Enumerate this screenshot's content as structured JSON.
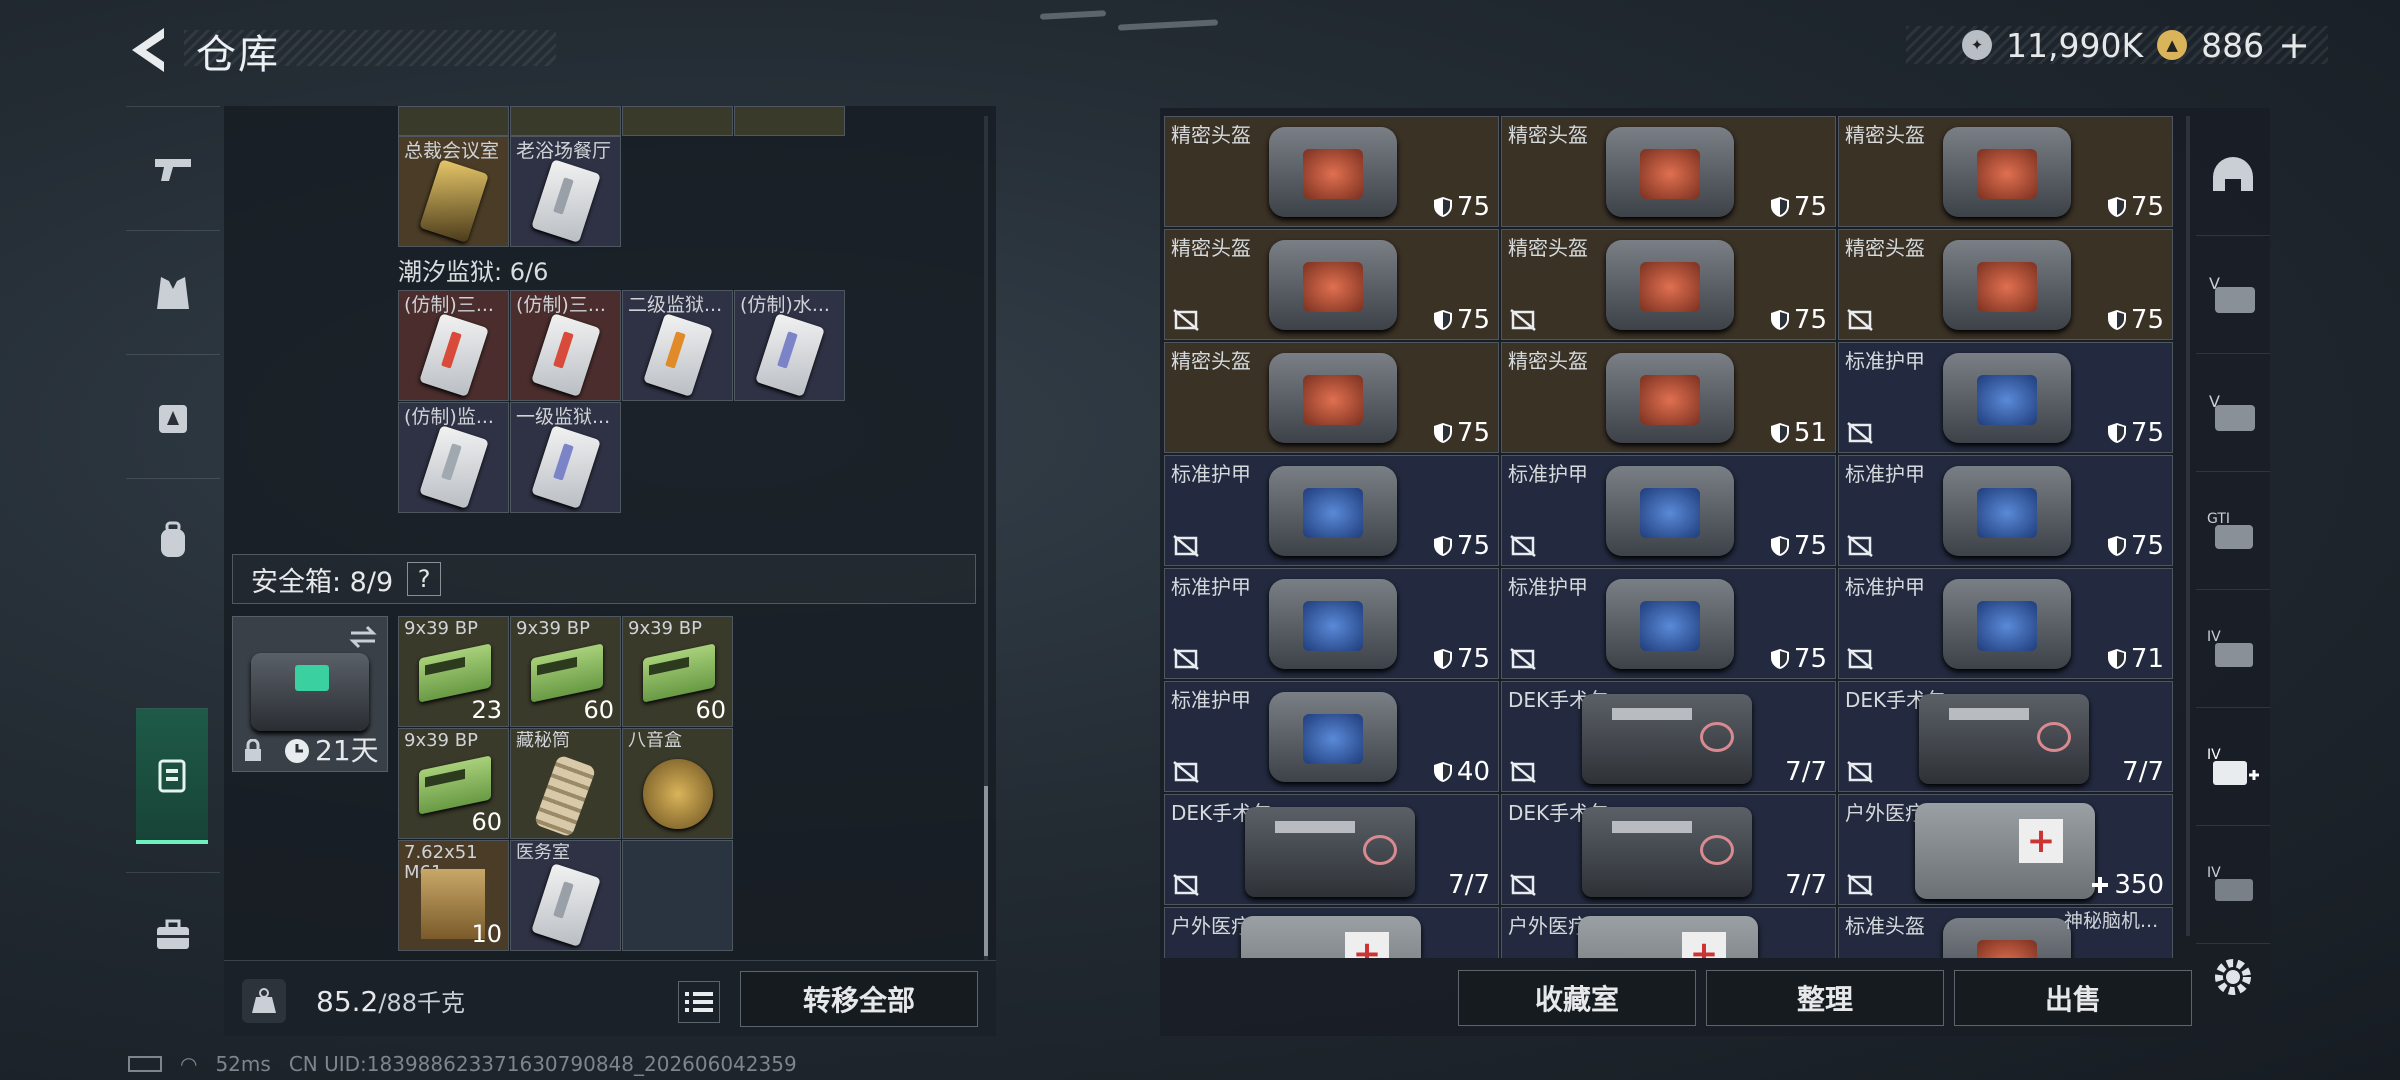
{
  "header": {
    "title": "仓库",
    "currency_silver": "11,990K",
    "currency_gold": "886",
    "add_label": "+"
  },
  "left_panel": {
    "top_keys": [
      {
        "name": "总裁会议室",
        "style": "gold"
      },
      {
        "name": "老浴场餐厅",
        "style": "purple"
      }
    ],
    "section_prison": "潮汐监狱: 6/6",
    "prison_keys": [
      {
        "name": "(仿制)三...",
        "style": "red",
        "stripe": "#d84a3a"
      },
      {
        "name": "(仿制)三...",
        "style": "red",
        "stripe": "#d84a3a"
      },
      {
        "name": "二级监狱...",
        "style": "purple",
        "stripe": "#e08a2a"
      },
      {
        "name": "(仿制)水...",
        "style": "purple",
        "stripe": "#7c84c8"
      },
      {
        "name": "(仿制)监...",
        "style": "purple",
        "stripe": "#a0a8b0"
      },
      {
        "name": "一级监狱...",
        "style": "purple",
        "stripe": "#7c84c8"
      }
    ],
    "safe_box_label": "安全箱: 8/9",
    "help": "?",
    "safe_timer": "21天",
    "safe_items": [
      {
        "name": "9x39 BP",
        "count": "23",
        "kind": "ammo"
      },
      {
        "name": "9x39 BP",
        "count": "60",
        "kind": "ammo"
      },
      {
        "name": "9x39 BP",
        "count": "60",
        "kind": "ammo"
      },
      {
        "name": "9x39 BP",
        "count": "60",
        "kind": "ammo"
      },
      {
        "name": "藏秘筒",
        "count": "",
        "kind": "cylinder"
      },
      {
        "name": "八音盒",
        "count": "",
        "kind": "musicbox"
      },
      {
        "name": "7.62x51 M61",
        "count": "10",
        "kind": "rifle"
      },
      {
        "name": "医务室",
        "count": "",
        "kind": "key"
      }
    ],
    "weight": "85.2",
    "weight_max": "/88千克",
    "transfer_all": "转移全部"
  },
  "right_panel": {
    "items": [
      {
        "name": "精密头盔",
        "dur": "75",
        "type": "helmet",
        "locked": false
      },
      {
        "name": "精密头盔",
        "dur": "75",
        "type": "helmet",
        "locked": false
      },
      {
        "name": "精密头盔",
        "dur": "75",
        "type": "helmet",
        "locked": false
      },
      {
        "name": "精密头盔",
        "dur": "75",
        "type": "helmet",
        "locked": true
      },
      {
        "name": "精密头盔",
        "dur": "75",
        "type": "helmet",
        "locked": true
      },
      {
        "name": "精密头盔",
        "dur": "75",
        "type": "helmet",
        "locked": true
      },
      {
        "name": "精密头盔",
        "dur": "75",
        "type": "helmet",
        "locked": false
      },
      {
        "name": "精密头盔",
        "dur": "51",
        "type": "helmet",
        "locked": false
      },
      {
        "name": "标准护甲",
        "dur": "75",
        "type": "armor",
        "locked": true
      },
      {
        "name": "标准护甲",
        "dur": "75",
        "type": "armor",
        "locked": true
      },
      {
        "name": "标准护甲",
        "dur": "75",
        "type": "armor",
        "locked": true
      },
      {
        "name": "标准护甲",
        "dur": "75",
        "type": "armor",
        "locked": true
      },
      {
        "name": "标准护甲",
        "dur": "75",
        "type": "armor",
        "locked": true
      },
      {
        "name": "标准护甲",
        "dur": "75",
        "type": "armor",
        "locked": true
      },
      {
        "name": "标准护甲",
        "dur": "71",
        "type": "armor",
        "locked": true
      },
      {
        "name": "标准护甲",
        "dur": "40",
        "type": "armor",
        "locked": true
      },
      {
        "name": "DEK手术包",
        "dur": "7/7",
        "type": "medkit",
        "locked": true
      },
      {
        "name": "DEK手术包",
        "dur": "7/7",
        "type": "medkit",
        "locked": true
      },
      {
        "name": "DEK手术包",
        "dur": "7/7",
        "type": "medkit",
        "locked": true
      },
      {
        "name": "DEK手术包",
        "dur": "7/7",
        "type": "medkit",
        "locked": true
      },
      {
        "name": "户外医疗箱",
        "dur": "350",
        "type": "firstaid",
        "locked": true
      },
      {
        "name": "户外医疗箱",
        "dur": "",
        "type": "firstaid",
        "locked": false
      },
      {
        "name": "户外医疗箱",
        "dur": "",
        "type": "firstaid",
        "locked": false
      },
      {
        "name": "标准头盔",
        "dur": "",
        "type": "helmet",
        "locked": false
      }
    ],
    "partial_label": "神秘脑机...",
    "buttons": {
      "collection": "收藏室",
      "sort": "整理",
      "sell": "出售"
    }
  },
  "footer": {
    "ping": "52ms",
    "uid": "CN UID:18398862337163079​0848_202606042359"
  }
}
